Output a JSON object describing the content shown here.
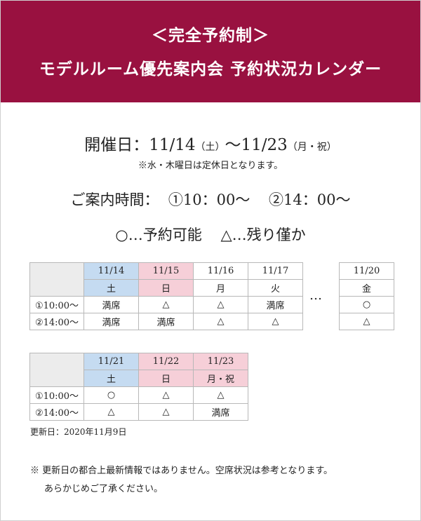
{
  "header": {
    "subtitle": "＜完全予約制＞",
    "title": "モデルルーム優先案内会 予約状況カレンダー"
  },
  "period": {
    "label": "開催日：",
    "start": "11/14",
    "start_dow": "（土）",
    "tilde": "〜",
    "end": "11/23",
    "end_dow": "（月・祝）"
  },
  "closed_note": "※水・木曜日は定休日となります。",
  "hours": {
    "label": "ご案内時間：",
    "slot1": "①10：00〜",
    "slot2": "②14：00〜"
  },
  "legend": {
    "available": "○…予約可能",
    "few": "△…残り僅か"
  },
  "colors": {
    "banner": "#991140",
    "saturday": "#c5dbf1",
    "holiday": "#f6cfd8",
    "corner": "#ececec"
  },
  "table1": {
    "rows": [
      "①10:00〜",
      "②14:00〜"
    ],
    "days": [
      {
        "date": "11/14",
        "dow": "土",
        "slots": [
          "満席",
          "満席"
        ]
      },
      {
        "date": "11/15",
        "dow": "日",
        "slots": [
          "△",
          "満席"
        ]
      },
      {
        "date": "11/16",
        "dow": "月",
        "slots": [
          "△",
          "△"
        ]
      },
      {
        "date": "11/17",
        "dow": "火",
        "slots": [
          "満席",
          "△"
        ]
      }
    ]
  },
  "ellipsis": "…",
  "table_extra": {
    "day": {
      "date": "11/20",
      "dow": "金",
      "slots": [
        "○",
        "△"
      ]
    }
  },
  "table2": {
    "rows": [
      "①10:00〜",
      "②14:00〜"
    ],
    "days": [
      {
        "date": "11/21",
        "dow": "土",
        "slots": [
          "○",
          "△"
        ]
      },
      {
        "date": "11/22",
        "dow": "日",
        "slots": [
          "△",
          "△"
        ]
      },
      {
        "date": "11/23",
        "dow": "月・祝",
        "slots": [
          "△",
          "満席"
        ]
      }
    ]
  },
  "updated": "更新日：2020年11月9日",
  "footer_note": {
    "line1": "※ 更新日の都合上最新情報ではありません。空席状況は参考となります。",
    "line2": "あらかじめご了承ください。"
  }
}
